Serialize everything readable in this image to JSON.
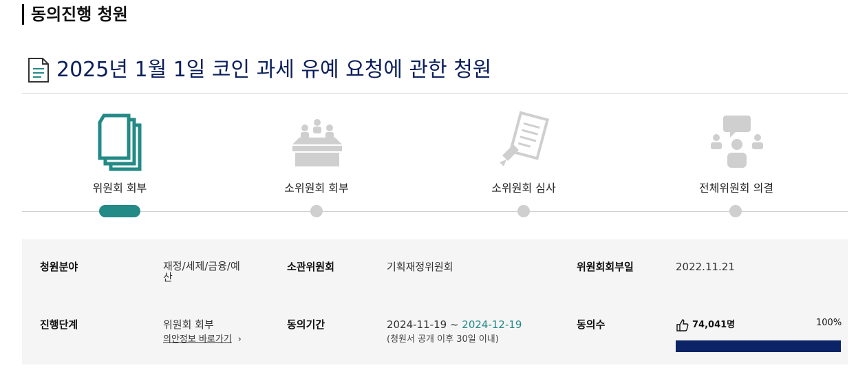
{
  "section": {
    "title": "동의진행 청원"
  },
  "petition": {
    "title": "2025년 1월 1일 코인 과세 유예 요청에 관한 청원"
  },
  "steps": [
    {
      "label": "위원회 회부",
      "icon": "documents-icon",
      "active": true
    },
    {
      "label": "소위원회 회부",
      "icon": "meeting-table-icon",
      "active": false
    },
    {
      "label": "소위원회 심사",
      "icon": "review-document-icon",
      "active": false
    },
    {
      "label": "전체위원회 의결",
      "icon": "plenary-speech-icon",
      "active": false
    }
  ],
  "info": {
    "field_label": "청원분야",
    "field_value_line1": "재정/세제/금융/예",
    "field_value_line2": "산",
    "committee_label": "소관위원회",
    "committee_value": "기획재정위원회",
    "referral_date_label": "위원회회부일",
    "referral_date_value": "2022.11.21",
    "stage_label": "진행단계",
    "stage_value": "위원회 회부",
    "stage_link": "의안정보 바로가기",
    "period_label": "동의기간",
    "period_start": "2024-11-19 ~ ",
    "period_end": "2024-12-19",
    "period_note": "(청원서 공개 이후 30일 이내)",
    "agree_label": "동의수",
    "agree_count": "74,041명",
    "agree_percent": "100%",
    "agree_progress": 1.0
  },
  "colors": {
    "accent": "#238a86",
    "navy": "#0c2366",
    "inactive": "#cfcfcf"
  }
}
